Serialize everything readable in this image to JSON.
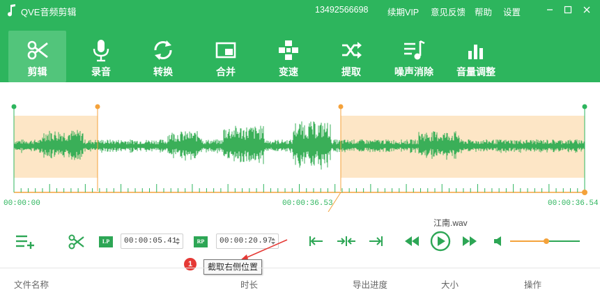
{
  "titlebar": {
    "app_title": "QVE音频剪辑",
    "phone": "13492566698",
    "renew": "续期VIP",
    "feedback": "意见反馈",
    "help": "帮助",
    "settings": "设置"
  },
  "toolbar": {
    "items": [
      {
        "label": "剪辑",
        "icon": "scissors-icon",
        "active": true
      },
      {
        "label": "录音",
        "icon": "microphone-icon"
      },
      {
        "label": "转换",
        "icon": "convert-icon"
      },
      {
        "label": "合并",
        "icon": "merge-icon"
      },
      {
        "label": "变速",
        "icon": "speed-icon"
      },
      {
        "label": "提取",
        "icon": "extract-icon"
      },
      {
        "label": "噪声消除",
        "icon": "denoise-icon"
      },
      {
        "label": "音量调整",
        "icon": "volume-adjust-icon"
      }
    ]
  },
  "waveform": {
    "start_time": "00:00:00",
    "mid_time": "00:00:36.53",
    "end_time": "00:00:36.54",
    "left_marker_fraction": 0.145,
    "right_marker_fraction": 0.574
  },
  "controls": {
    "lp_label": "LP",
    "rp_label": "RP",
    "left_time": "00:00:05.41",
    "right_time": "00:00:20.97",
    "file_name": "江南.wav",
    "volume_fraction": 0.52
  },
  "annotation": {
    "badge": "1",
    "tooltip": "截取右侧位置"
  },
  "table": {
    "columns": [
      "文件名称",
      "时长",
      "导出进度",
      "大小",
      "操作"
    ]
  },
  "colors": {
    "brand_green": "#2db55d",
    "active_tab": "#52c57b",
    "selection_fill": "#fde6c6",
    "marker_orange": "#f4a23b",
    "annotation_red": "#e53935"
  }
}
